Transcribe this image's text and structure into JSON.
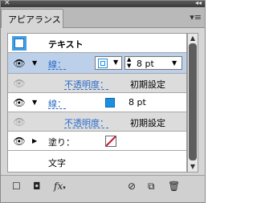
{
  "panel": {
    "tab_label": "アピアランス",
    "close_glyph": "✕",
    "collapse_glyph": "◂◂",
    "menu_glyph": "▾≡"
  },
  "object_row": {
    "label": "テキスト"
  },
  "rows": [
    {
      "label": "線：",
      "weight": "8 pt",
      "expanded": true
    },
    {
      "label": "不透明度：",
      "value": "初期設定"
    },
    {
      "label": "線：",
      "weight": "8 pt",
      "expanded": true,
      "swatch_color": "#1e8fe0"
    },
    {
      "label": "不透明度：",
      "value": "初期設定"
    },
    {
      "label": "塗り：",
      "expanded": false
    }
  ],
  "characters_row": {
    "label": "文字"
  },
  "colors": {
    "accent": "#2a6bc9",
    "selected_row": "#bcd0ea",
    "stroke_swatch": "#1e8fe0",
    "none_slash": "#c8102e"
  }
}
